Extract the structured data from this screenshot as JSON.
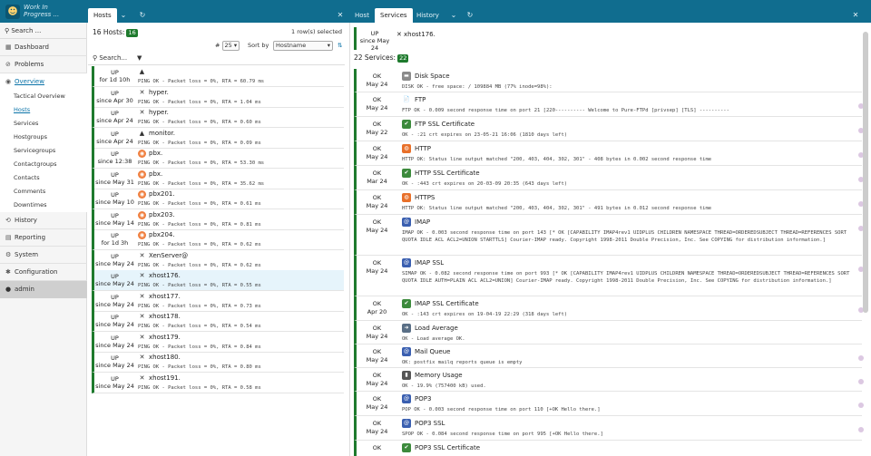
{
  "app": {
    "logo_line1": "Work In",
    "logo_line2": "Progress ..."
  },
  "tabs_left": [
    {
      "label": "Hosts"
    }
  ],
  "tabs_right": [
    {
      "label": "Host"
    },
    {
      "label": "Services"
    },
    {
      "label": "History"
    }
  ],
  "sidebar": {
    "search_label": "Search ...",
    "items": [
      {
        "label": "Dashboard",
        "icon": "dashboard-icon"
      },
      {
        "label": "Problems",
        "icon": "problems-icon"
      },
      {
        "label": "Overview",
        "icon": "overview-icon"
      }
    ],
    "overview_sub": [
      "Tactical Overview",
      "Hosts",
      "Services",
      "Hostgroups",
      "Servicegroups",
      "Contactgroups",
      "Contacts",
      "Comments",
      "Downtimes"
    ],
    "items_after": [
      {
        "label": "History",
        "icon": "history-icon"
      },
      {
        "label": "Reporting",
        "icon": "reporting-icon"
      },
      {
        "label": "System",
        "icon": "system-icon"
      },
      {
        "label": "Configuration",
        "icon": "configuration-icon"
      }
    ],
    "user": "admin"
  },
  "hosts_pane": {
    "count_label": "16 Hosts:",
    "count": "16",
    "rows_selected": "1 row(s) selected",
    "limit_prefix": "#",
    "limit_value": "25",
    "sort_label": "Sort by",
    "sort_value": "Hostname",
    "search_label": "Search...",
    "rows": [
      {
        "state": "UP",
        "since": "for 1d 10h",
        "name": "",
        "output": "PING OK - Packet loss = 0%, RTA = 60.79 ms",
        "icon": "linux-icon"
      },
      {
        "state": "UP",
        "since": "since Apr 30",
        "name": "hyper.",
        "output": "PING OK - Packet loss = 0%, RTA = 1.04 ms",
        "icon": "xen-icon"
      },
      {
        "state": "UP",
        "since": "since Apr 24",
        "name": "hyper.",
        "output": "PING OK - Packet loss = 0%, RTA = 0.60 ms",
        "icon": "xen-icon"
      },
      {
        "state": "UP",
        "since": "since Apr 24",
        "name": "monitor.",
        "output": "PING OK - Packet loss = 0%, RTA = 0.09 ms",
        "icon": "linux-icon"
      },
      {
        "state": "UP",
        "since": "since 12:38",
        "name": "pbx.",
        "output": "PING OK - Packet loss = 0%, RTA = 53.30 ms",
        "icon": "pbx-icon"
      },
      {
        "state": "UP",
        "since": "since May 31",
        "name": "pbx.",
        "output": "PING OK - Packet loss = 0%, RTA = 35.62 ms",
        "icon": "pbx-icon"
      },
      {
        "state": "UP",
        "since": "since May 10",
        "name": "pbx201.",
        "output": "PING OK - Packet loss = 0%, RTA = 0.61 ms",
        "icon": "pbx-icon"
      },
      {
        "state": "UP",
        "since": "since May 14",
        "name": "pbx203.",
        "output": "PING OK - Packet loss = 0%, RTA = 0.81 ms",
        "icon": "pbx-icon"
      },
      {
        "state": "UP",
        "since": "for 1d 3h",
        "name": "pbx204.",
        "output": "PING OK - Packet loss = 0%, RTA = 0.62 ms",
        "icon": "pbx-icon"
      },
      {
        "state": "UP",
        "since": "since May 24",
        "name": "XenServer@",
        "output": "PING OK - Packet loss = 0%, RTA = 0.62 ms",
        "icon": "xen-icon"
      },
      {
        "state": "UP",
        "since": "since May 24",
        "name": "xhost176.",
        "output": "PING OK - Packet loss = 0%, RTA = 0.55 ms",
        "icon": "xen-icon",
        "highlight": true
      },
      {
        "state": "UP",
        "since": "since May 24",
        "name": "xhost177.",
        "output": "PING OK - Packet loss = 0%, RTA = 0.73 ms",
        "icon": "xen-icon"
      },
      {
        "state": "UP",
        "since": "since May 24",
        "name": "xhost178.",
        "output": "PING OK - Packet loss = 0%, RTA = 0.54 ms",
        "icon": "xen-icon"
      },
      {
        "state": "UP",
        "since": "since May 24",
        "name": "xhost179.",
        "output": "PING OK - Packet loss = 0%, RTA = 0.84 ms",
        "icon": "xen-icon"
      },
      {
        "state": "UP",
        "since": "since May 24",
        "name": "xhost180.",
        "output": "PING OK - Packet loss = 0%, RTA = 0.80 ms",
        "icon": "xen-icon"
      },
      {
        "state": "UP",
        "since": "since May 24",
        "name": "xhost191.",
        "output": "PING OK - Packet loss = 0%, RTA = 0.58 ms",
        "icon": "xen-icon"
      }
    ]
  },
  "detail": {
    "host_state": "UP",
    "host_since": "since May 24",
    "host_name": "xhost176.",
    "host_ip": "",
    "services_label": "22 Services:",
    "services_count": "22",
    "services": [
      {
        "state": "OK",
        "since": "May 24",
        "name": "Disk Space",
        "output": "DISK OK - free space: / 109884 MB (77% inode=98%):",
        "icon": "disk-icon",
        "color": "#8a8a8a",
        "h": 26
      },
      {
        "state": "OK",
        "since": "May 24",
        "name": "FTP",
        "output": "FTP OK - 0.009 second response time on  port 21 [220---------- Welcome to Pure-FTPd [privsep] [TLS] ----------",
        "icon": "ftp-icon",
        "color": "#ffffff",
        "h": 27
      },
      {
        "state": "OK",
        "since": "May 22",
        "name": "FTP SSL Certificate",
        "output": "OK - :21 crt expires on 23-05-21 16:06 (1810 days left)",
        "icon": "shield-icon",
        "color": "#3c8a3c",
        "h": 27
      },
      {
        "state": "OK",
        "since": "May 24",
        "name": "HTTP",
        "output": "HTTP OK: Status line output matched \"200, 403, 404, 302, 301\" - 408 bytes in 0.002 second response time",
        "icon": "firefox-icon",
        "color": "#e8702a",
        "h": 27
      },
      {
        "state": "OK",
        "since": "Mar 24",
        "name": "HTTP SSL Certificate",
        "output": "OK - :443 crt expires on 20-03-09 20:35 (643 days left)",
        "icon": "shield-icon",
        "color": "#3c8a3c",
        "h": 27
      },
      {
        "state": "OK",
        "since": "May 24",
        "name": "HTTPS",
        "output": "HTTP OK: Status line output matched \"200, 403, 404, 302, 301\" - 491 bytes in 0.012 second response time",
        "icon": "firefox-icon",
        "color": "#e8702a",
        "h": 27
      },
      {
        "state": "OK",
        "since": "May 24",
        "name": "IMAP",
        "output": "IMAP OK - 0.003 second response time on  port 143 [* OK [CAPABILITY IMAP4rev1 UIDPLUS CHILDREN NAMESPACE THREAD=ORDEREDSUBJECT THREAD=REFERENCES SORT QUOTA IDLE ACL ACL2=UNION STARTTLS] Courier-IMAP ready. Copyright 1998-2011 Double Precision, Inc.  See COPYING for distribution information.]",
        "icon": "at-icon",
        "color": "#3a5fb0",
        "h": 45
      },
      {
        "state": "OK",
        "since": "May 24",
        "name": "IMAP SSL",
        "output": "SIMAP OK - 0.082 second response time on  port 993 [* OK [CAPABILITY IMAP4rev1 UIDPLUS CHILDREN NAMESPACE THREAD=ORDEREDSUBJECT THREAD=REFERENCES SORT QUOTA IDLE AUTH=PLAIN ACL ACL2=UNION] Courier-IMAP ready. Copyright 1998-2011 Double Precision, Inc.  See COPYING for distribution information.]",
        "icon": "at-icon",
        "color": "#3a5fb0",
        "h": 45
      },
      {
        "state": "OK",
        "since": "Apr 20",
        "name": "IMAP SSL Certificate",
        "output": "OK - :143 crt expires on 19-04-19 22:29 (318 days left)",
        "icon": "shield-icon",
        "color": "#3c8a3c",
        "h": 27
      },
      {
        "state": "OK",
        "since": "May 24",
        "name": "Load Average",
        "output": "OK - Load average OK.",
        "icon": "load-icon",
        "color": "#5a6f86",
        "h": 26
      },
      {
        "state": "OK",
        "since": "May 24",
        "name": "Mail Queue",
        "output": "OK: postfix mailq reports queue is empty",
        "icon": "at-icon",
        "color": "#3a5fb0",
        "h": 26
      },
      {
        "state": "OK",
        "since": "May 24",
        "name": "Memory Usage",
        "output": "OK - 19.9% (757400 kB) used.",
        "icon": "memory-icon",
        "color": "#555555",
        "h": 26
      },
      {
        "state": "OK",
        "since": "May 24",
        "name": "POP3",
        "output": "POP OK - 0.003 second response time on  port 110 [+OK Hello there.]",
        "icon": "at-icon",
        "color": "#3a5fb0",
        "h": 27
      },
      {
        "state": "OK",
        "since": "May 24",
        "name": "POP3 SSL",
        "output": "SPOP OK - 0.084 second response time on  port 995 [+OK Hello there.]",
        "icon": "at-icon",
        "color": "#3a5fb0",
        "h": 27
      },
      {
        "state": "OK",
        "since": "",
        "name": "POP3 SSL Certificate",
        "output": "",
        "icon": "shield-icon",
        "color": "#3c8a3c",
        "h": 20
      }
    ]
  },
  "colors": {
    "topbar": "#106d8f",
    "up_green": "#1e7a2d",
    "highlight": "#e6f4fb",
    "link": "#0a73a8"
  }
}
